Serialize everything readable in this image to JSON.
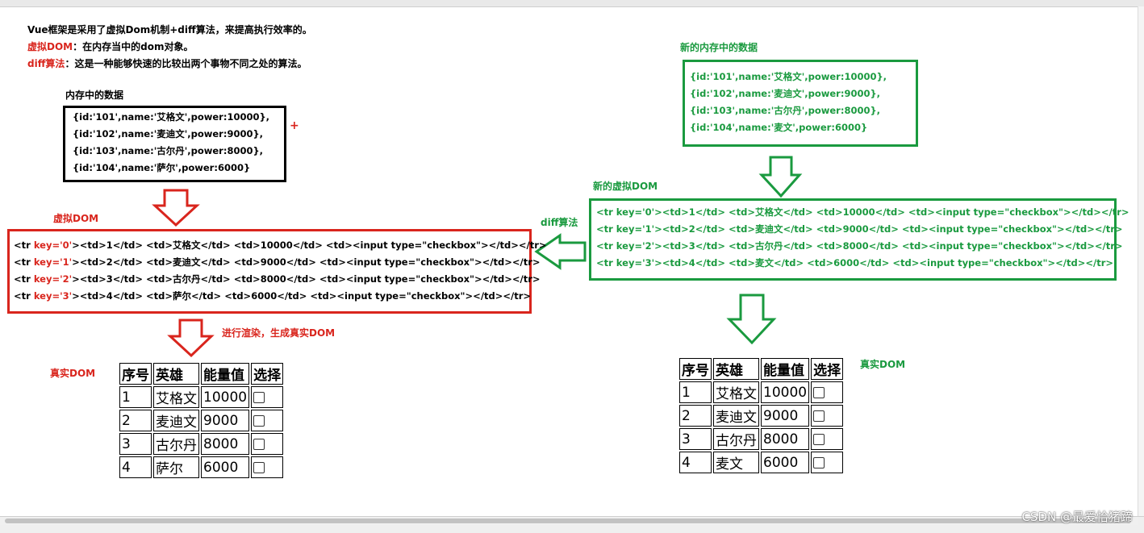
{
  "intro": {
    "line1": "Vue框架是采用了虚拟Dom机制+diff算法，来提高执行效率的。",
    "line2_term": "虚拟DOM",
    "line2_text": "：在内存当中的dom对象。",
    "line3_term": "diff算法",
    "line3_text": "：这是一种能够快速的比较出两个事物不同之处的算法。"
  },
  "memory_data": {
    "title": "内存中的数据",
    "plus": "+",
    "lines": [
      "{id:'101',name:'艾格文',power:10000},",
      "{id:'102',name:'麦迪文',power:9000},",
      "{id:'103',name:'古尔丹',power:8000},",
      "{id:'104',name:'萨尔',power:6000}"
    ]
  },
  "new_memory_data": {
    "title": "新的内存中的数据",
    "lines": [
      "{id:'101',name:'艾格文',power:10000},",
      "{id:'102',name:'麦迪文',power:9000},",
      "{id:'103',name:'古尔丹',power:8000},",
      "{id:'104',name:'麦文',power:6000}"
    ]
  },
  "virtual_dom": {
    "title": "虚拟DOM",
    "rows": [
      {
        "pre": "<tr ",
        "key": "key='0'",
        "post": "><td>1</td> <td>艾格文</td> <td>10000</td> <td><input type=\"checkbox\"></td></tr>"
      },
      {
        "pre": "<tr ",
        "key": "key='1'",
        "post": "><td>2</td> <td>麦迪文</td> <td>9000</td> <td><input type=\"checkbox\"></td></tr>"
      },
      {
        "pre": "<tr ",
        "key": "key='2'",
        "post": "><td>3</td> <td>古尔丹</td> <td>8000</td> <td><input type=\"checkbox\"></td></tr>"
      },
      {
        "pre": "<tr ",
        "key": "key='3'",
        "post": "><td>4</td> <td>萨尔</td> <td>6000</td> <td><input type=\"checkbox\"></td></tr>"
      }
    ]
  },
  "new_virtual_dom": {
    "title": "新的虚拟DOM",
    "rows": [
      "<tr key='0'><td>1</td> <td>艾格文</td> <td>10000</td> <td><input type=\"checkbox\"></td></tr>",
      "<tr key='1'><td>2</td> <td>麦迪文</td> <td>9000</td> <td><input type=\"checkbox\"></td></tr>",
      "<tr key='2'><td>3</td> <td>古尔丹</td> <td>8000</td> <td><input type=\"checkbox\"></td></tr>",
      "<tr key='3'><td>4</td> <td>麦文</td> <td>6000</td> <td><input type=\"checkbox\"></td></tr>"
    ]
  },
  "diff_label": "diff算法",
  "render_label": "进行渲染，生成真实DOM",
  "real_dom_label": "真实DOM",
  "new_real_dom_label": "真实DOM",
  "real_dom_table": {
    "headers": [
      "序号",
      "英雄",
      "能量值",
      "选择"
    ],
    "rows": [
      [
        "1",
        "艾格文",
        "10000"
      ],
      [
        "2",
        "麦迪文",
        "9000"
      ],
      [
        "3",
        "古尔丹",
        "8000"
      ],
      [
        "4",
        "萨尔",
        "6000"
      ]
    ]
  },
  "new_real_dom_table": {
    "headers": [
      "序号",
      "英雄",
      "能量值",
      "选择"
    ],
    "rows": [
      [
        "1",
        "艾格文",
        "10000"
      ],
      [
        "2",
        "麦迪文",
        "9000"
      ],
      [
        "3",
        "古尔丹",
        "8000"
      ],
      [
        "4",
        "麦文",
        "6000"
      ]
    ]
  },
  "watermark": "CSDN @最爱恰猪蹄",
  "colors": {
    "red": "#d9251d",
    "green": "#1a9a3f",
    "black": "#000000"
  }
}
